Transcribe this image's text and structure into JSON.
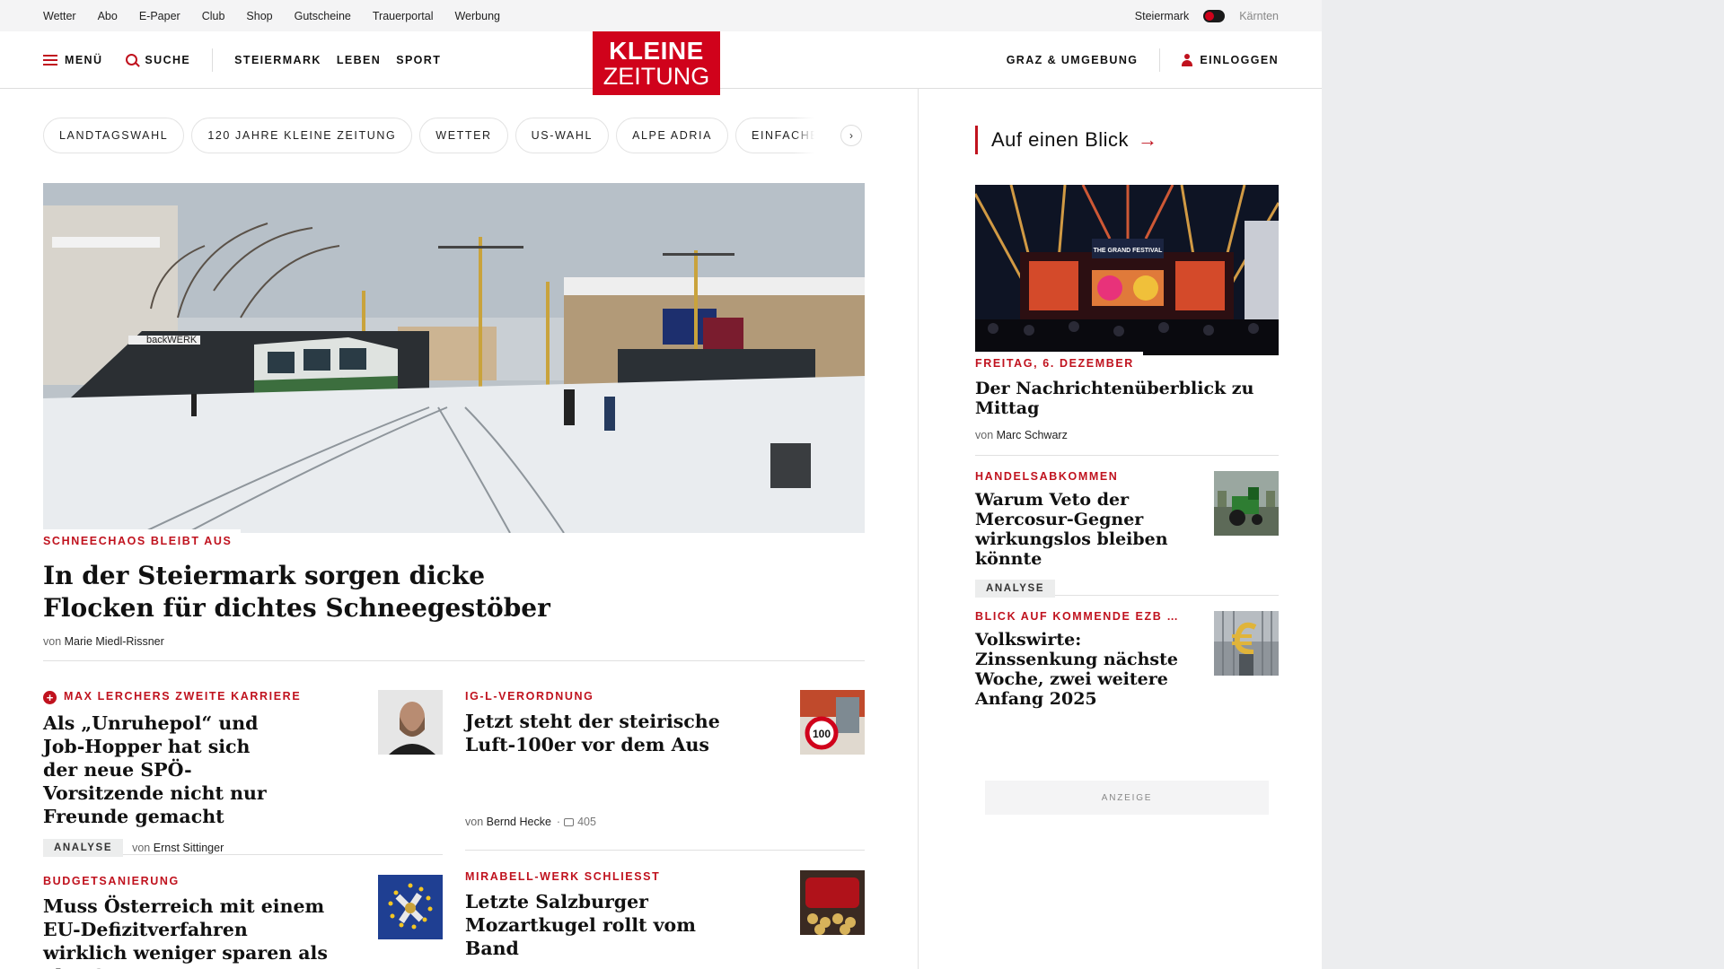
{
  "topbar": {
    "links": [
      "Wetter",
      "Abo",
      "E-Paper",
      "Club",
      "Shop",
      "Gutscheine",
      "Trauerportal",
      "Werbung"
    ],
    "region_active": "Steiermark",
    "region_other": "Kärnten"
  },
  "header": {
    "menu_label": "Menü",
    "search_label": "Suche",
    "nav": [
      "Steiermark",
      "Leben",
      "Sport"
    ],
    "logo_line1": "KLEINE",
    "logo_line2": "ZEITUNG",
    "local_label": "Graz & Umgebung",
    "login_label": "Einloggen"
  },
  "chips": [
    "Landtagswahl",
    "120 Jahre Kleine Zeitung",
    "Wetter",
    "US-Wahl",
    "Alpe Adria",
    "Einfache Sprache"
  ],
  "hero": {
    "kicker": "Schneechaos bleibt aus",
    "title": "In der Steiermark sorgen dicke Flocken für dichtes Schneegestöber",
    "by": "von",
    "author": "Marie Miedl-Rissner",
    "image_text": "backWERK"
  },
  "teasers": [
    {
      "kicker": "Max Lerchers zweite Karriere",
      "premium": true,
      "title": "Als „Unruhepol“ und Job-Hopper hat sich der neue SPÖ-Vorsitzende nicht nur Freunde gemacht",
      "badge": "Analyse",
      "by": "von",
      "author": "Ernst Sittinger",
      "icon": "portrait-photo"
    },
    {
      "kicker": "IG-L-Verordnung",
      "title": "Jetzt steht der steirische Luft-100er vor dem Aus",
      "by": "von",
      "author": "Bernd Hecke",
      "comments": "405",
      "sign_text": "100",
      "icon": "speed-sign-photo"
    },
    {
      "kicker": "Budgetsanierung",
      "title": "Muss Österreich mit einem EU-Defizitverfahren wirklich weniger sparen als ohne?",
      "icon": "eu-flag-photo"
    },
    {
      "kicker": "Mirabell-Werk schließt",
      "title": "Letzte Salzburger Mozartkugel rollt vom Band",
      "icon": "mozartkugel-photo"
    }
  ],
  "aside": {
    "heading": "Auf einen Blick",
    "feature": {
      "kicker": "Freitag, 6. Dezember",
      "title": "Der Nachrichtenüberblick zu Mittag",
      "by": "von",
      "author": "Marc Schwarz",
      "stage_text": "THE GRAND FESTIVAL"
    },
    "items": [
      {
        "kicker": "Handelsabkommen",
        "title": "Warum Veto der Mercosur-Gegner wirkungslos bleiben könnte",
        "badge": "Analyse",
        "icon": "tractor-photo"
      },
      {
        "kicker": "Blick auf kommende EZB …",
        "title": "Volkswirte: Zinssenkung nächste Woche, zwei weitere Anfang 2025",
        "icon": "euro-sculpture-photo"
      }
    ],
    "ad_label": "Anzeige"
  },
  "colors": {
    "brand_red": "#d0021b",
    "kicker_red": "#c0121e",
    "page_bg": "#ecedef"
  }
}
